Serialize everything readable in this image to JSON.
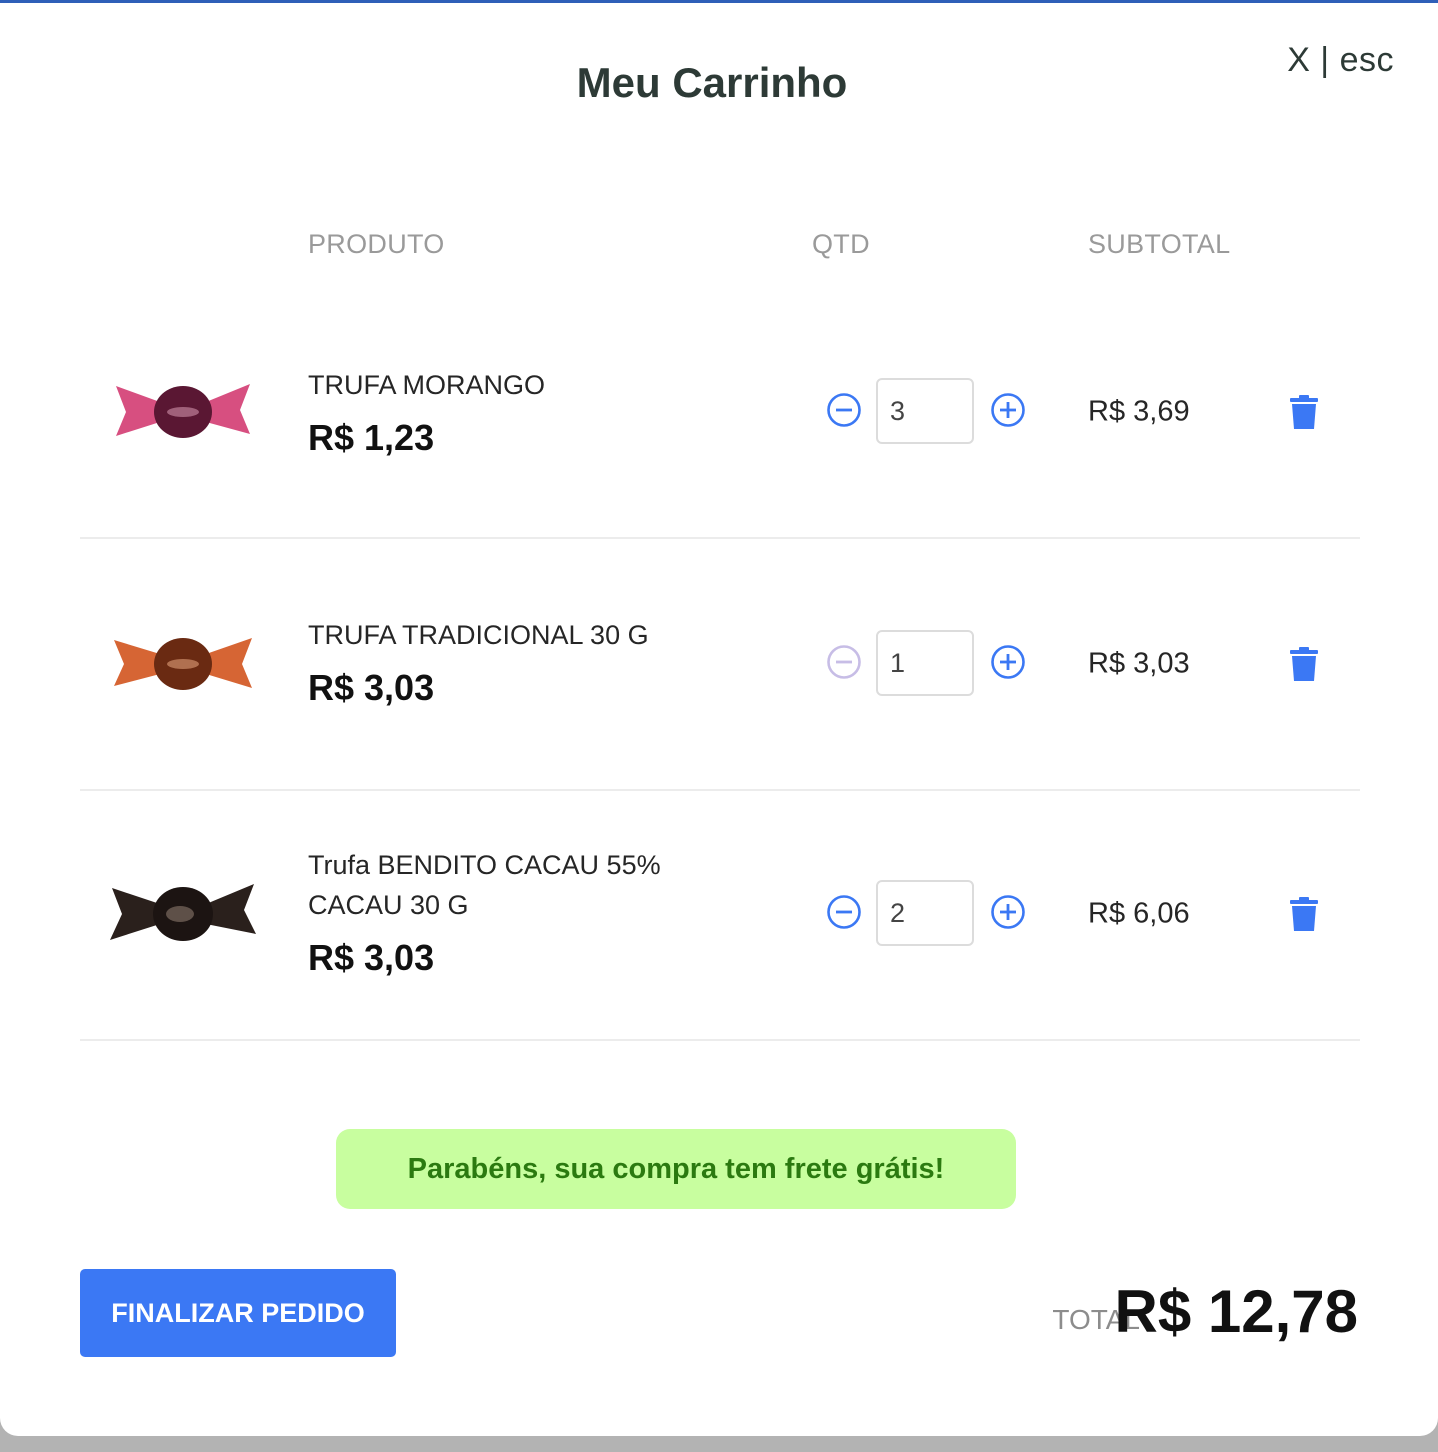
{
  "modal": {
    "title": "Meu Carrinho",
    "close_label": "X | esc"
  },
  "columns": {
    "produto": "PRODUTO",
    "qtd": "QTD",
    "subtotal": "SUBTOTAL"
  },
  "items": [
    {
      "name": "TRUFA MORANGO",
      "price": "R$ 1,23",
      "qty": "3",
      "subtotal": "R$ 3,69",
      "wrapper_color": "#d0306a",
      "minus_enabled": true
    },
    {
      "name": "TRUFA TRADICIONAL 30 G",
      "price": "R$ 3,03",
      "qty": "1",
      "subtotal": "R$ 3,03",
      "wrapper_color": "#d2541e",
      "minus_enabled": false
    },
    {
      "name": "Trufa BENDITO CACAU 55% CACAU 30 G",
      "price": "R$ 3,03",
      "qty": "2",
      "subtotal": "R$ 6,06",
      "wrapper_color": "#2a201c",
      "minus_enabled": true
    }
  ],
  "banner": {
    "text": "Parabéns, sua compra tem frete grátis!"
  },
  "footer": {
    "finalize_label": "FINALIZAR PEDIDO",
    "total_label": "TOTAL",
    "total_value": "R$ 12,78"
  },
  "colors": {
    "accent": "#3b78f4",
    "banner_bg": "#c8fe9f",
    "banner_text": "#2b7a10",
    "minus_disabled": "#c7bde6"
  },
  "icons": {
    "minus": "minus-circle-icon",
    "plus": "plus-circle-icon",
    "delete": "trash-icon"
  }
}
